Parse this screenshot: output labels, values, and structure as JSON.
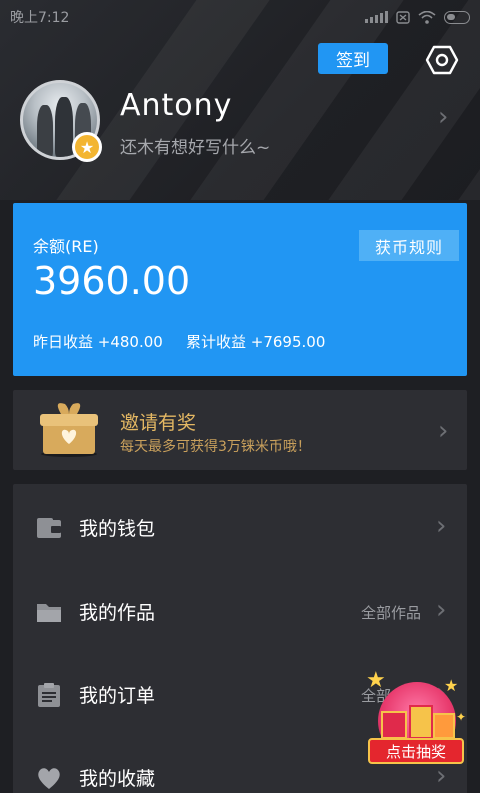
{
  "status_bar": {
    "time": "晚上7:12"
  },
  "header": {
    "checkin_label": "签到"
  },
  "profile": {
    "name": "Antony",
    "bio": "还木有想好写什么~"
  },
  "balance": {
    "label": "余额(RE)",
    "amount": "3960.00",
    "rules_label": "获币规则",
    "yesterday": "昨日收益 +480.00",
    "total": "累计收益 +7695.00"
  },
  "invite": {
    "title": "邀请有奖",
    "subtitle": "每天最多可获得3万铼米币哦！"
  },
  "menu": {
    "items": [
      {
        "label": "我的钱包",
        "right": ""
      },
      {
        "label": "我的作品",
        "right": "全部作品"
      },
      {
        "label": "我的订单",
        "right": "全部"
      },
      {
        "label": "我的收藏",
        "right": ""
      }
    ]
  },
  "lottery": {
    "label": "点击抽奖"
  },
  "colors": {
    "accent": "#2196f3",
    "gold": "#e3b763",
    "background": "#1e1f23",
    "card": "#2d2e33"
  }
}
